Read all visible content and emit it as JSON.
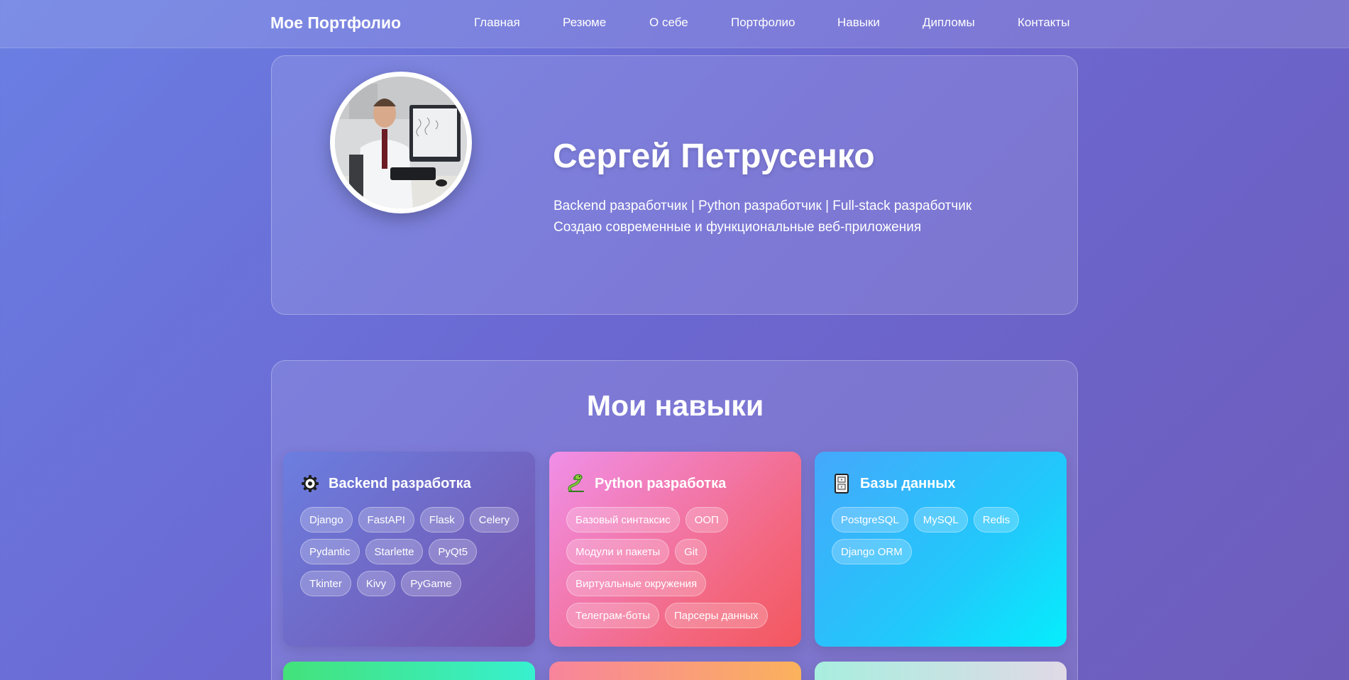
{
  "nav": {
    "brand": "Мое Портфолио",
    "links": [
      "Главная",
      "Резюме",
      "О себе",
      "Портфолио",
      "Навыки",
      "Дипломы",
      "Контакты"
    ]
  },
  "hero": {
    "name": "Сергей Петрусенко",
    "subtitle_line1": "Backend разработчик | Python разработчик | Full-stack разработчик",
    "subtitle_line2": "Создаю современные и функциональные веб-приложения"
  },
  "skills": {
    "title": "Мои навыки",
    "cards": [
      {
        "title": "Backend разработка",
        "icon": "gear-icon",
        "tags": [
          "Django",
          "FastAPI",
          "Flask",
          "Celery",
          "Pydantic",
          "Starlette",
          "PyQt5",
          "Tkinter",
          "Kivy",
          "PyGame"
        ]
      },
      {
        "title": "Python разработка",
        "icon": "snake-icon",
        "tags": [
          "Базовый синтаксис",
          "ООП",
          "Модули и пакеты",
          "Git",
          "Виртуальные окружения",
          "Телеграм-боты",
          "Парсеры данных"
        ]
      },
      {
        "title": "Базы данных",
        "icon": "database-icon",
        "tags": [
          "PostgreSQL",
          "MySQL",
          "Redis",
          "Django ORM"
        ]
      }
    ]
  }
}
